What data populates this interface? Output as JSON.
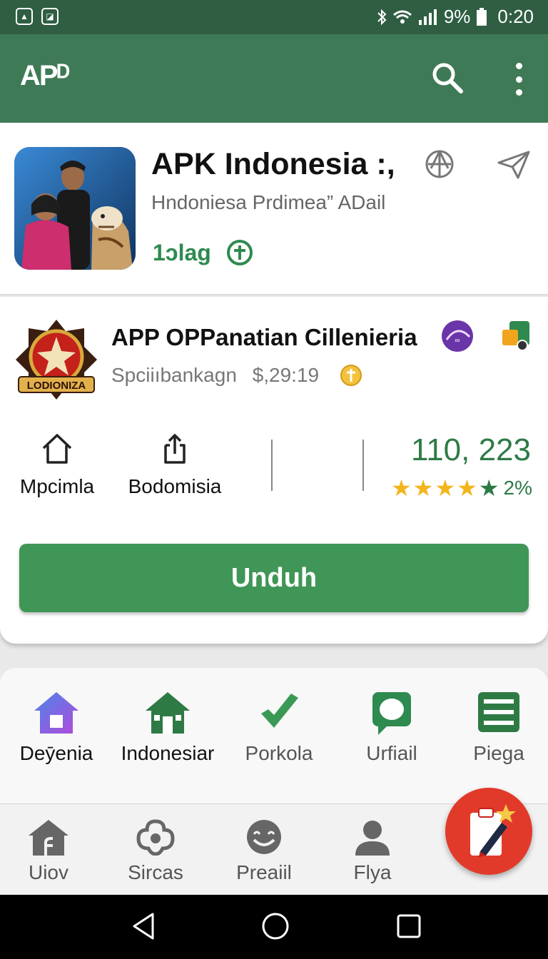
{
  "status_bar": {
    "battery": "9%",
    "time": "0:20"
  },
  "app_bar": {
    "logo": "APD",
    "logo_display": "APᴰ"
  },
  "featured": {
    "title": "APK Indonesia :,",
    "subtitle": "Hndoniesa  Prdimea”  ADail",
    "tag": "1ɔlag"
  },
  "detail": {
    "title": "APP OPPanatian Cillenieria",
    "subtitle": "Spciiıbankagn",
    "price": "$,29:19",
    "badge_text": "LODIONIZA",
    "stats": [
      {
        "label": "Mpcimla",
        "icon": "home-icon"
      },
      {
        "label": "Bodomisia",
        "icon": "share-upload-icon"
      }
    ],
    "count": "110, 223",
    "rating_stars": 4.5,
    "rating_pct": "2%",
    "download_label": "Unduh"
  },
  "categories": [
    {
      "label": "Deȳenia",
      "icon": "home-icon",
      "color": "#6b5ce7"
    },
    {
      "label": "Indonesiar",
      "icon": "house-icon",
      "color": "#2e7a45"
    },
    {
      "label": "Porkola",
      "icon": "phone-icon",
      "color": "#3a9a55"
    },
    {
      "label": "Urfiail",
      "icon": "chat-icon",
      "color": "#2e8a4f"
    },
    {
      "label": "Piega",
      "icon": "list-icon",
      "color": "#2e7a45"
    }
  ],
  "bottom_nav": [
    {
      "label": "Uiov",
      "icon": "home-icon"
    },
    {
      "label": "Sircas",
      "icon": "apps-icon"
    },
    {
      "label": "Preaiil",
      "icon": "face-icon"
    },
    {
      "label": "Flya",
      "icon": "profile-icon"
    }
  ],
  "colors": {
    "primary": "#3f7a56",
    "status_bar": "#2f5e43",
    "accent_green": "#3f9656",
    "fab": "#e23a2a"
  }
}
